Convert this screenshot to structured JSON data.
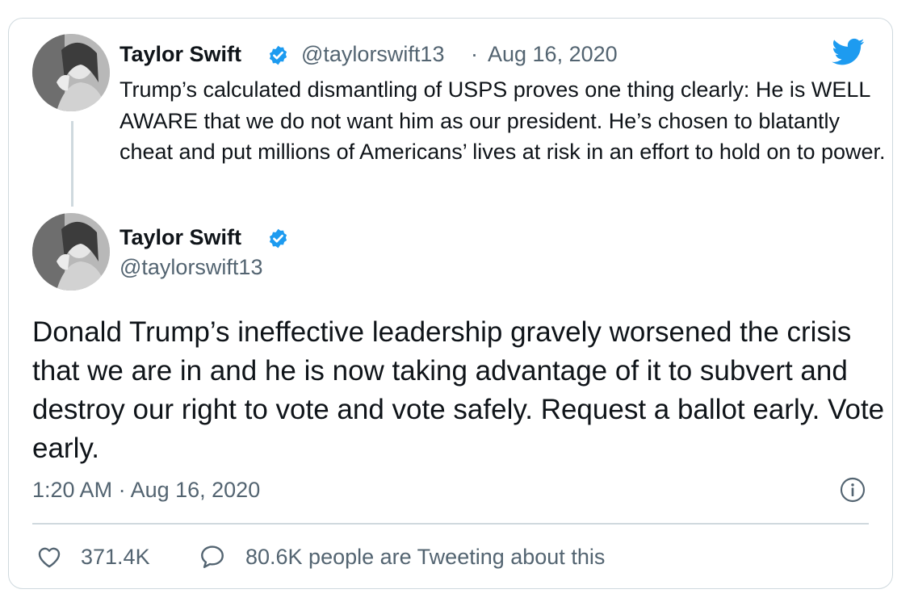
{
  "quoted_tweet": {
    "author_name": "Taylor Swift",
    "handle": "@taylorswift13",
    "separator": "·",
    "date": "Aug 16, 2020",
    "text": "Trump’s calculated dismantling of USPS proves one thing clearly: He is WELL AWARE that we do not want him as our president. He’s chosen to blatantly cheat and put millions of Americans’ lives at risk in an effort to hold on to power."
  },
  "main_tweet": {
    "author_name": "Taylor Swift",
    "handle": "@taylorswift13",
    "text": "Donald Trump’s ineffective leadership gravely worsened the crisis that we are in and he is now taking advantage of it to subvert and destroy our right to vote and vote safely. Request a ballot early. Vote early.",
    "timestamp": "1:20 AM · Aug 16, 2020"
  },
  "actions": {
    "likes": "371.4K",
    "replies_label": "80.6K people are Tweeting about this"
  },
  "icons": {
    "logo": "twitter-bird-icon",
    "verified": "verified-badge-icon",
    "info": "info-icon",
    "like": "heart-icon",
    "reply": "speech-bubble-icon"
  },
  "colors": {
    "twitter_blue": "#1d9bf0",
    "text_primary": "#0f1419",
    "text_secondary": "#536471",
    "border": "#cfd9de"
  }
}
